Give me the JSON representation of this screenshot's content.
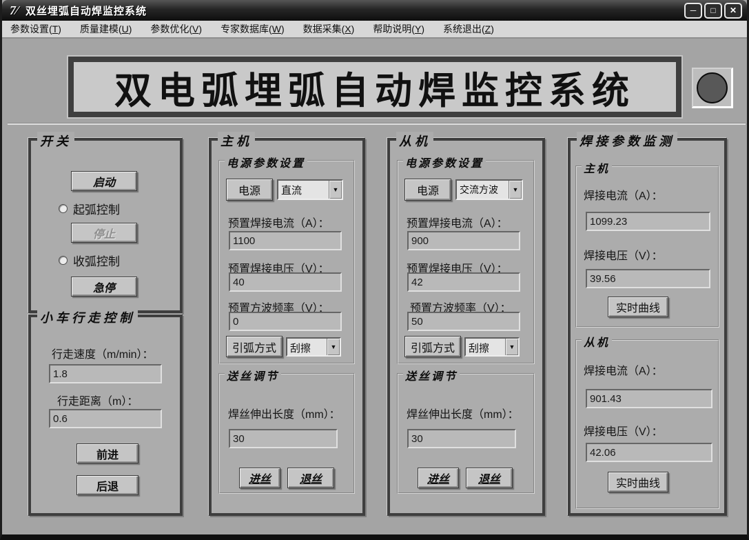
{
  "window": {
    "title": "双丝埋弧自动焊监控系统",
    "icon_glyph": "7⁄",
    "controls": {
      "minimize": "─",
      "maximize": "□",
      "close": "✕"
    }
  },
  "menu": {
    "items": [
      {
        "pre": "参数设置(",
        "key": "T",
        "post": ")"
      },
      {
        "pre": "质量建模(",
        "key": "U",
        "post": ")"
      },
      {
        "pre": "参数优化(",
        "key": "V",
        "post": ")"
      },
      {
        "pre": "专家数据库(",
        "key": "W",
        "post": ")"
      },
      {
        "pre": "数据采集(",
        "key": "X",
        "post": ")"
      },
      {
        "pre": "帮助说明(",
        "key": "Y",
        "post": ")"
      },
      {
        "pre": "系统退出(",
        "key": "Z",
        "post": ")"
      }
    ]
  },
  "banner": {
    "title": "双电弧埋弧自动焊监控系统",
    "indicator_color": "#585858"
  },
  "switch_panel": {
    "title": "开关",
    "start_button": "启动",
    "arc_start_radio": "起弧控制",
    "stop_button": "停止",
    "arc_end_radio": "收弧控制",
    "estop_button": "急停"
  },
  "carriage_panel": {
    "title": "小车行走控制",
    "speed_label": "行走速度（m/min）：",
    "speed_value": "1.8",
    "distance_label": "行走距离（m）：",
    "distance_value": "0.6",
    "forward_button": "前进",
    "backward_button": "后退"
  },
  "master_panel": {
    "title": "主机",
    "power_group": {
      "title": "电源参数设置",
      "power_button": "电源",
      "power_mode": "直流",
      "current_label": "预置焊接电流（A）：",
      "current_value": "1100",
      "voltage_label": "预置焊接电压（V）：",
      "voltage_value": "40",
      "freq_label": "预置方波频率（V）：",
      "freq_value": "0",
      "arc_button": "引弧方式",
      "arc_mode": "刮擦"
    },
    "wire_group": {
      "title": "送丝调节",
      "stickout_label": "焊丝伸出长度（mm）：",
      "stickout_value": "30",
      "feed_button": "进丝",
      "retract_button": "退丝"
    }
  },
  "slave_panel": {
    "title": "从机",
    "power_group": {
      "title": "电源参数设置",
      "power_button": "电源",
      "power_mode": "交流方波",
      "current_label": "预置焊接电流（A）：",
      "current_value": "900",
      "voltage_label": "预置焊接电压（V）：",
      "voltage_value": "42",
      "freq_label": "预置方波频率（V）：",
      "freq_value": "50",
      "arc_button": "引弧方式",
      "arc_mode": "刮擦"
    },
    "wire_group": {
      "title": "送丝调节",
      "stickout_label": "焊丝伸出长度（mm）：",
      "stickout_value": "30",
      "feed_button": "进丝",
      "retract_button": "退丝"
    }
  },
  "monitor_panel": {
    "title": "焊接参数监测",
    "master": {
      "title": "主机",
      "current_label": "焊接电流（A）：",
      "current_value": "1099.23",
      "voltage_label": "焊接电压（V）：",
      "voltage_value": "39.56",
      "curve_button": "实时曲线"
    },
    "slave": {
      "title": "从机",
      "current_label": "焊接电流（A）：",
      "current_value": "901.43",
      "voltage_label": "焊接电压（V）：",
      "voltage_value": "42.06",
      "curve_button": "实时曲线"
    }
  },
  "dropdown_arrow": "▼"
}
